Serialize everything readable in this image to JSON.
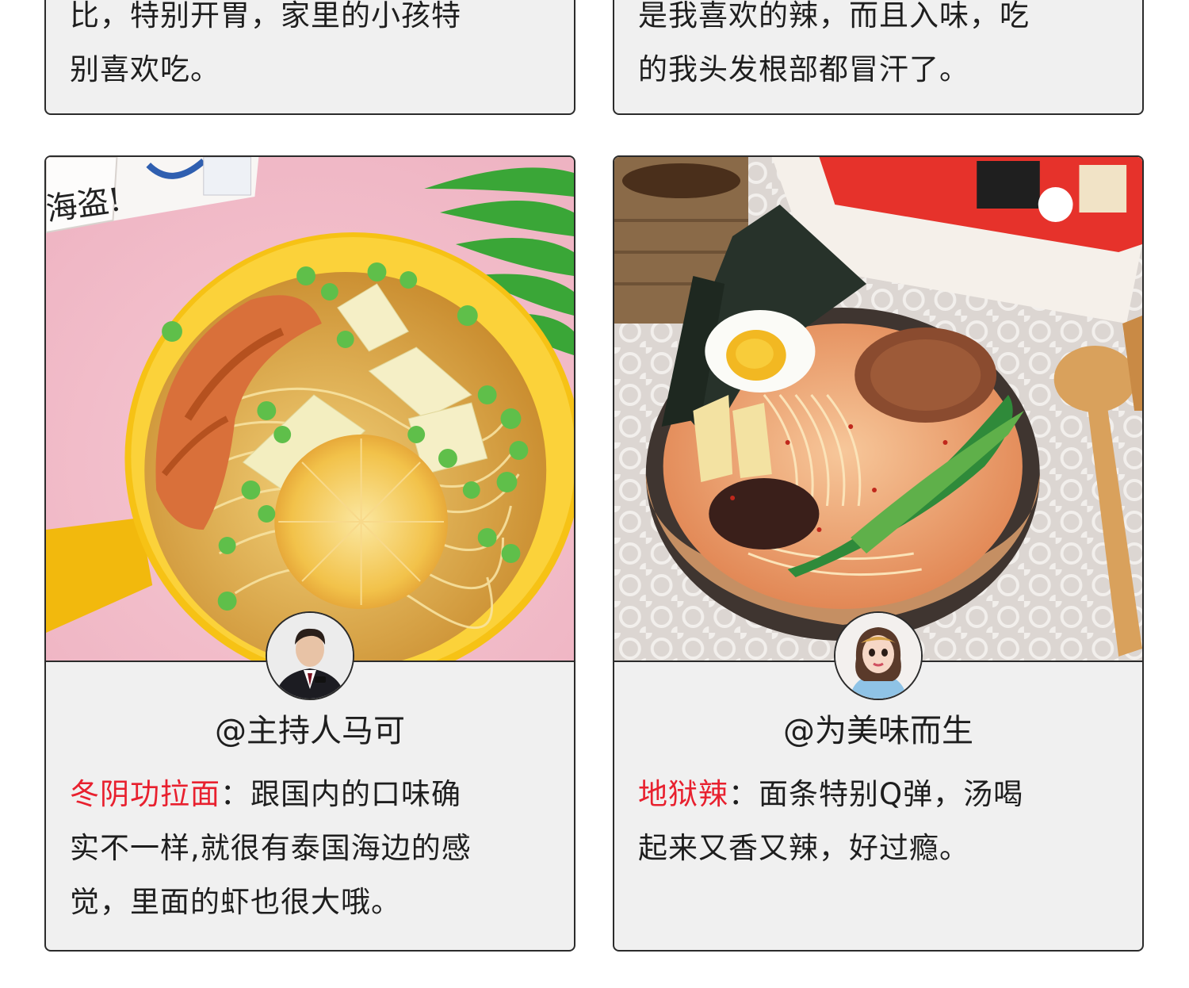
{
  "colors": {
    "highlight": "#e8202e",
    "card_bg": "#f0f0f0",
    "border": "#2b2b2b"
  },
  "top_cards": [
    {
      "line1": "比，特别开胃，家里的小孩特",
      "line2": "别喜欢吃。"
    },
    {
      "line1": "是我喜欢的辣，而且入味，吃",
      "line2": "的我头发根部都冒汗了。"
    }
  ],
  "reviews": [
    {
      "photo_icon": "tom-yum-noodle-bowl-photo",
      "avatar_icon": "host-man-in-suit-avatar",
      "photo_box_text": "海盗!",
      "author": "@主持人马可",
      "flavor": "冬阴功拉面",
      "sep": "：",
      "line1_rest": "跟国内的口味确",
      "line2": "实不一样,就很有泰国海边的感",
      "line3": "觉，里面的虾也很大哦。"
    },
    {
      "photo_icon": "spicy-ramen-bowl-photo",
      "avatar_icon": "cartoon-girl-avatar",
      "author": "@为美味而生",
      "flavor": "地狱辣",
      "sep": "：",
      "line1_rest": "面条特别Q弹，汤喝",
      "line2": "起来又香又辣，好过瘾。"
    }
  ]
}
